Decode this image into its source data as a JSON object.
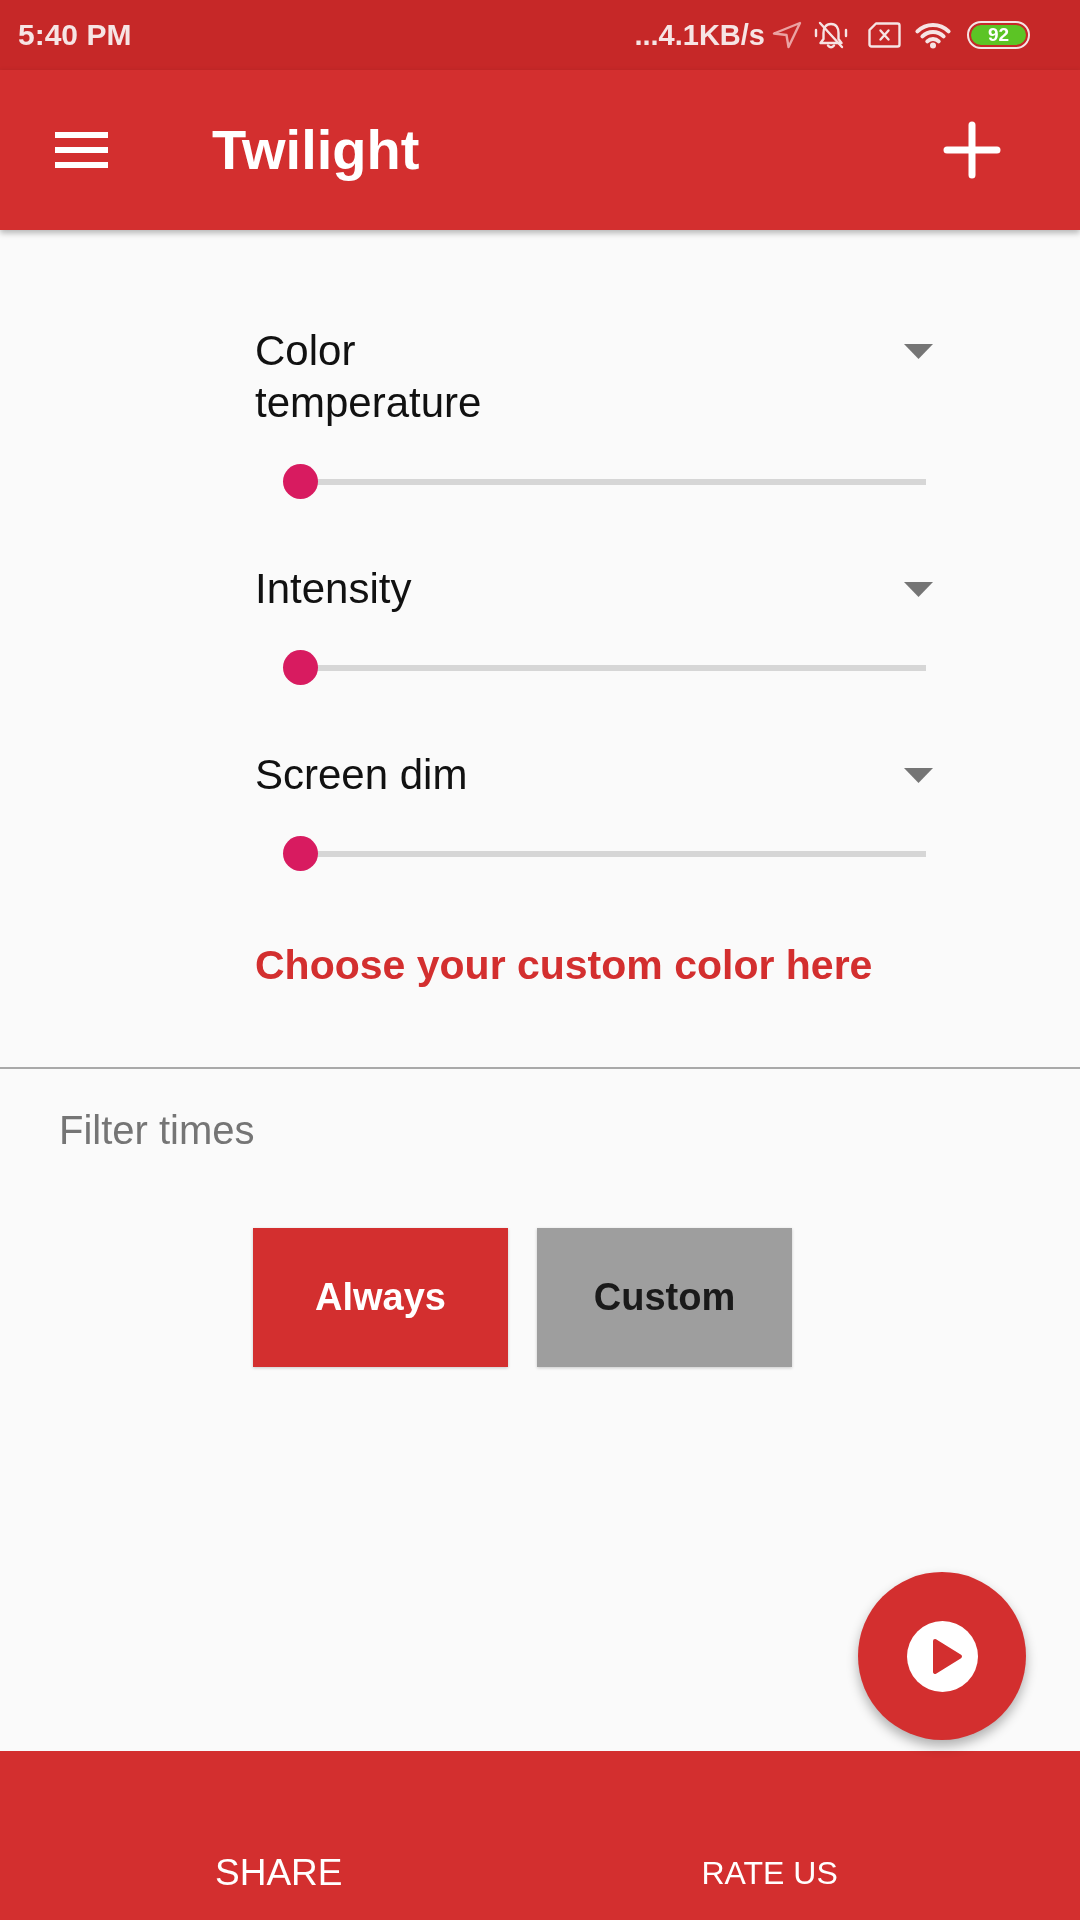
{
  "status_bar": {
    "time": "5:40 PM",
    "network_speed": "...4.1KB/s",
    "battery": "92"
  },
  "app_bar": {
    "title": "Twilight"
  },
  "sliders": [
    {
      "label": "Color temperature",
      "level": 0
    },
    {
      "label": "Intensity",
      "level": 0
    },
    {
      "label": "Screen dim",
      "level": 0
    }
  ],
  "custom_color_link": "Choose your custom color here",
  "filter_times": {
    "label": "Filter times",
    "options": [
      {
        "label": "Always",
        "selected": true
      },
      {
        "label": "Custom",
        "selected": false
      }
    ]
  },
  "bottom_bar": {
    "buttons": [
      "SHARE",
      "RATE US"
    ]
  }
}
